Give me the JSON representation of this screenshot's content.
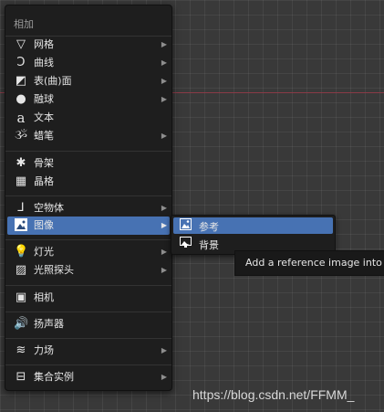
{
  "menu": {
    "title": "相加",
    "items": [
      {
        "label": "网格",
        "icon": "mesh-icon",
        "arrow": true
      },
      {
        "label": "曲线",
        "icon": "curve-icon",
        "arrow": true
      },
      {
        "label": "表(曲)面",
        "icon": "surface-icon",
        "arrow": true
      },
      {
        "label": "融球",
        "icon": "metaball-icon",
        "arrow": true
      },
      {
        "label": "文本",
        "icon": "text-icon",
        "arrow": false
      },
      {
        "label": "蜡笔",
        "icon": "grease-pencil-icon",
        "arrow": true
      },
      {
        "label": "骨架",
        "icon": "armature-icon",
        "arrow": false
      },
      {
        "label": "晶格",
        "icon": "lattice-icon",
        "arrow": false
      },
      {
        "label": "空物体",
        "icon": "empty-icon",
        "arrow": true
      },
      {
        "label": "图像",
        "icon": "image-icon",
        "arrow": true
      },
      {
        "label": "灯光",
        "icon": "light-icon",
        "arrow": true
      },
      {
        "label": "光照探头",
        "icon": "light-probe-icon",
        "arrow": true
      },
      {
        "label": "相机",
        "icon": "camera-icon",
        "arrow": false
      },
      {
        "label": "扬声器",
        "icon": "speaker-icon",
        "arrow": false
      },
      {
        "label": "力场",
        "icon": "force-field-icon",
        "arrow": true
      },
      {
        "label": "集合实例",
        "icon": "collection-instance-icon",
        "arrow": true
      }
    ]
  },
  "submenu": {
    "items": [
      {
        "label": "参考",
        "icon": "reference-image-icon"
      },
      {
        "label": "背景",
        "icon": "background-image-icon"
      }
    ]
  },
  "tooltip": {
    "text": "Add a reference image into the"
  },
  "watermark": {
    "text": "https://blog.csdn.net/FFMM_"
  },
  "colors": {
    "highlight": "#4772b3",
    "menu_bg": "#1e1e1e",
    "viewport_bg": "#393939",
    "x_axis": "#8a3a47"
  }
}
